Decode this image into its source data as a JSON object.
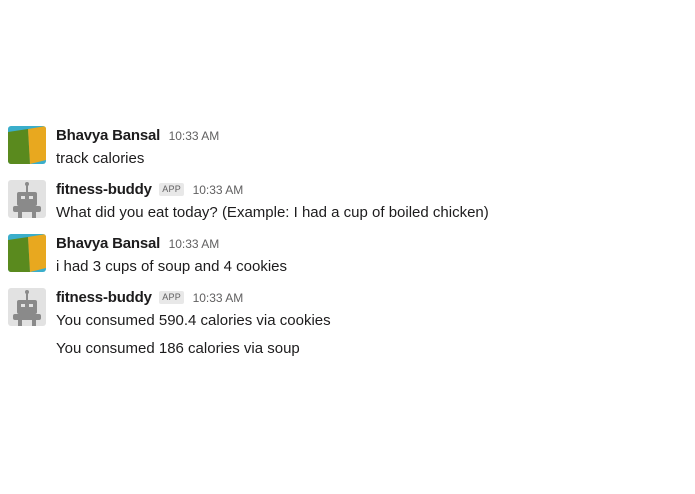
{
  "messages": [
    {
      "sender": "Bhavya Bansal",
      "time": "10:33 AM",
      "avatar": "user-avatar",
      "lines": [
        "track calories"
      ]
    },
    {
      "sender": "fitness-buddy",
      "badge": "APP",
      "time": "10:33 AM",
      "avatar": "bot-avatar",
      "lines": [
        "What did you eat today? (Example: I had a cup of boiled chicken)"
      ]
    },
    {
      "sender": "Bhavya Bansal",
      "time": "10:33 AM",
      "avatar": "user-avatar",
      "lines": [
        "i had 3 cups of soup and 4 cookies"
      ]
    },
    {
      "sender": "fitness-buddy",
      "badge": "APP",
      "time": "10:33 AM",
      "avatar": "bot-avatar",
      "lines": [
        "You consumed 590.4 calories via cookies",
        "You consumed 186 calories via soup"
      ]
    }
  ],
  "colors": {
    "user_avatar_green": "#5a8a1e",
    "user_avatar_yellow": "#e8a81f",
    "user_avatar_teal": "#3aaecb",
    "bot_avatar_bg": "#e2e2e2",
    "bot_avatar_robot": "#8a8a8a"
  }
}
